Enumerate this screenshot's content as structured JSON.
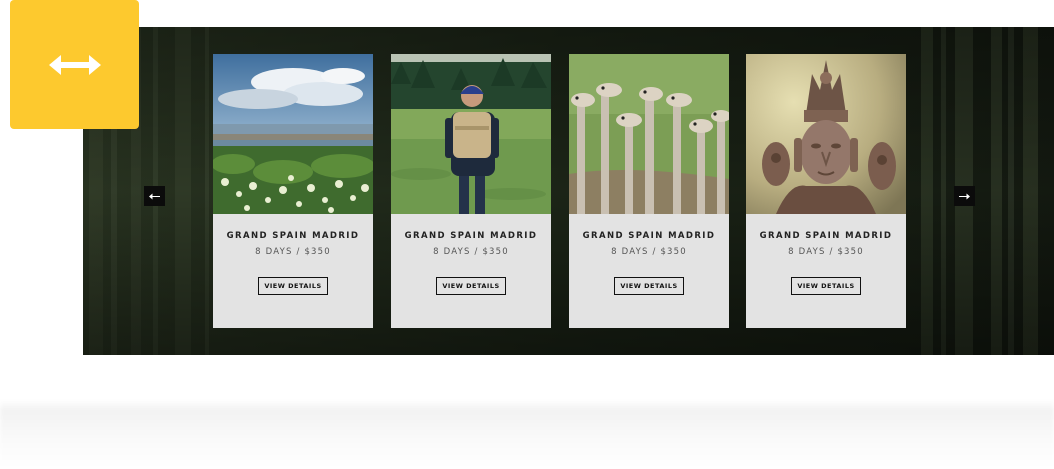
{
  "badge": {
    "icon": "horizontal-resize-icon",
    "color": "#fdc92e"
  },
  "slider": {
    "prev_icon": "arrow-left-icon",
    "next_icon": "arrow-right-icon",
    "cards": [
      {
        "title": "GRAND SPAIN MADRID",
        "meta": "8 DAYS / $350",
        "button_label": "VIEW DETAILS",
        "image": "coastal-landscape-photo"
      },
      {
        "title": "GRAND SPAIN MADRID",
        "meta": "8 DAYS / $350",
        "button_label": "VIEW DETAILS",
        "image": "hiker-in-field-photo"
      },
      {
        "title": "GRAND SPAIN MADRID",
        "meta": "8 DAYS / $350",
        "button_label": "VIEW DETAILS",
        "image": "ostriches-photo"
      },
      {
        "title": "GRAND SPAIN MADRID",
        "meta": "8 DAYS / $350",
        "button_label": "VIEW DETAILS",
        "image": "stone-statue-photo"
      }
    ]
  }
}
